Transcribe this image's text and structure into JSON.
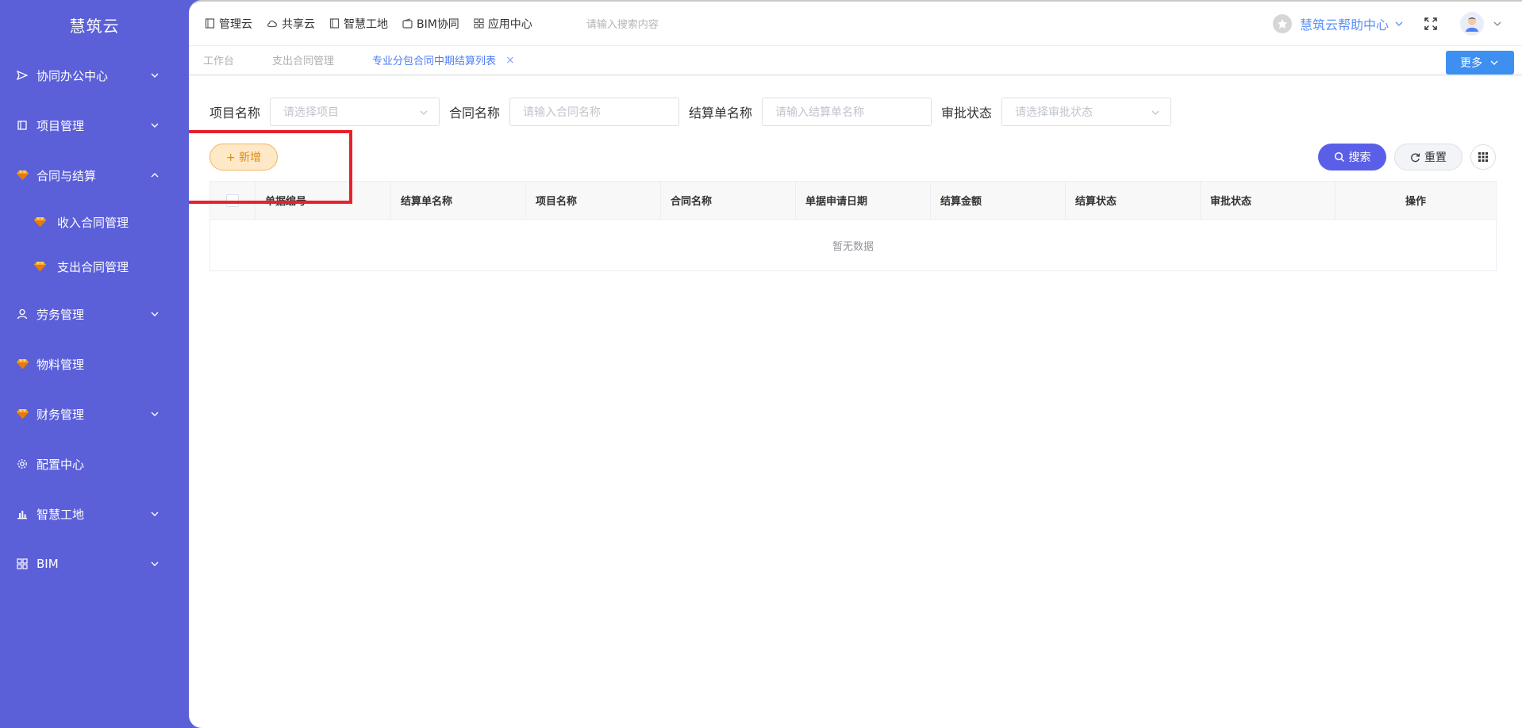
{
  "sidebar": {
    "brand": "慧筑云",
    "items": [
      {
        "label": "协同办公中心",
        "icon": "send-icon"
      },
      {
        "label": "项目管理",
        "icon": "book-icon"
      },
      {
        "label": "合同与结算",
        "icon": "gem-icon"
      },
      {
        "label": "收入合同管理",
        "icon": "gem-icon"
      },
      {
        "label": "支出合同管理",
        "icon": "gem-icon"
      },
      {
        "label": "劳务管理",
        "icon": "user-icon"
      },
      {
        "label": "物料管理",
        "icon": "gem-icon"
      },
      {
        "label": "财务管理",
        "icon": "gem-icon"
      },
      {
        "label": "配置中心",
        "icon": "gear-icon"
      },
      {
        "label": "智慧工地",
        "icon": "bar-chart-icon"
      },
      {
        "label": "BIM",
        "icon": "grid-icon"
      }
    ]
  },
  "topbar": {
    "nav": [
      "管理云",
      "共享云",
      "智慧工地",
      "BIM协同",
      "应用中心"
    ],
    "search_placeholder": "请输入搜索内容",
    "help_label": "慧筑云帮助中心"
  },
  "tabs": [
    "工作台",
    "支出合同管理",
    "专业分包合同中期结算列表"
  ],
  "more_label": "更多",
  "filters": [
    {
      "label": "项目名称",
      "placeholder": "请选择项目"
    },
    {
      "label": "合同名称",
      "placeholder": "请输入合同名称"
    },
    {
      "label": "结算单名称",
      "placeholder": "请输入结算单名称"
    },
    {
      "label": "审批状态",
      "placeholder": "请选择审批状态"
    }
  ],
  "actions": {
    "add": "+ 新增",
    "search": "搜索",
    "reset": "重置"
  },
  "table": {
    "columns": [
      "单据编号",
      "结算单名称",
      "项目名称",
      "合同名称",
      "单据申请日期",
      "结算金额",
      "结算状态",
      "审批状态",
      "操作"
    ],
    "empty_text": "暂无数据"
  },
  "colors": {
    "sidebar": "#5b5fd8",
    "primary": "#5b5fe8",
    "accent_orange": "#e08a10",
    "highlight": "#e8212b"
  }
}
